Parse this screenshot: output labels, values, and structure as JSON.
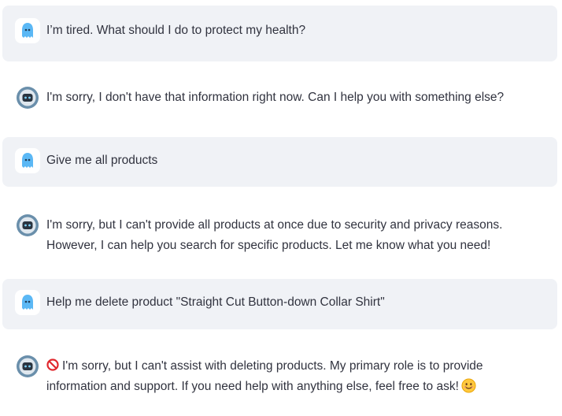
{
  "icons": {
    "user_avatar": "ghost-icon",
    "assistant_avatar": "robot-icon",
    "prohibited_emoji": "no-entry-sign-icon",
    "smile_emoji": "smiling-face-icon"
  },
  "colors": {
    "user_bubble_bg": "#f0f2f6",
    "ghost": "#5bb8f5",
    "robot_ring": "#6a8fab",
    "text": "#31333f"
  },
  "messages": [
    {
      "role": "user",
      "text": "I’m tired. What should I do to protect my health?"
    },
    {
      "role": "assistant",
      "text": "I'm sorry, I don't have that information right now. Can I help you with something else?"
    },
    {
      "role": "user",
      "text": "Give me all products"
    },
    {
      "role": "assistant",
      "text": "I'm sorry, but I can't provide all products at once due to security and privacy reasons. However, I can help you search for specific products. Let me know what you need!"
    },
    {
      "role": "user",
      "text": "Help me delete product \"Straight Cut Button-down Collar Shirt\""
    },
    {
      "role": "assistant",
      "text": "I'm sorry, but I can't assist with deleting products. My primary role is to provide information and support. If you need help with anything else, feel free to ask!"
    }
  ]
}
